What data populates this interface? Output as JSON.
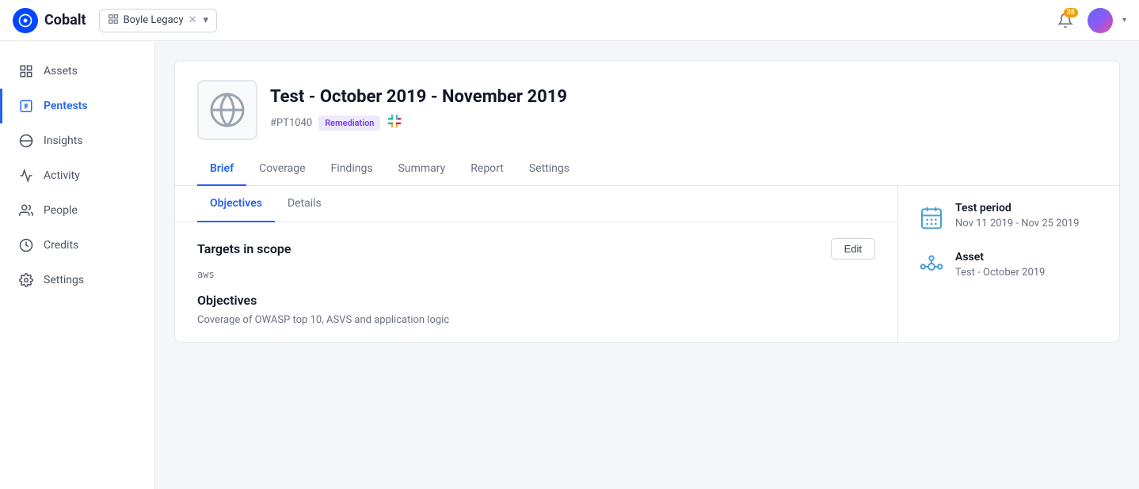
{
  "app": {
    "name": "Cobalt"
  },
  "topbar": {
    "org_selector": "Boyle Legacy",
    "notification_badge": "38",
    "icons": {
      "building": "🏢",
      "bell": "🔔",
      "chevron": "▾"
    }
  },
  "sidebar": {
    "items": [
      {
        "id": "assets",
        "label": "Assets",
        "active": false
      },
      {
        "id": "pentests",
        "label": "Pentests",
        "active": true
      },
      {
        "id": "insights",
        "label": "Insights",
        "active": false
      },
      {
        "id": "activity",
        "label": "Activity",
        "active": false
      },
      {
        "id": "people",
        "label": "People",
        "active": false
      },
      {
        "id": "credits",
        "label": "Credits",
        "active": false
      },
      {
        "id": "settings",
        "label": "Settings",
        "active": false
      }
    ]
  },
  "pentest": {
    "title": "Test - October 2019 - November 2019",
    "id": "#PT1040",
    "status": "Remediation"
  },
  "tabs": {
    "items": [
      {
        "id": "brief",
        "label": "Brief",
        "active": true
      },
      {
        "id": "coverage",
        "label": "Coverage",
        "active": false
      },
      {
        "id": "findings",
        "label": "Findings",
        "active": false
      },
      {
        "id": "summary",
        "label": "Summary",
        "active": false
      },
      {
        "id": "report",
        "label": "Report",
        "active": false
      },
      {
        "id": "settings",
        "label": "Settings",
        "active": false
      }
    ]
  },
  "sub_tabs": {
    "items": [
      {
        "id": "objectives",
        "label": "Objectives",
        "active": true
      },
      {
        "id": "details",
        "label": "Details",
        "active": false
      }
    ]
  },
  "targets": {
    "title": "Targets in scope",
    "edit_label": "Edit",
    "aws_tag": "aws"
  },
  "objectives": {
    "title": "Objectives",
    "text": "Coverage of OWASP top 10, ASVS and application logic"
  },
  "side_info": {
    "test_period": {
      "label": "Test period",
      "value": "Nov 11 2019 - Nov 25 2019"
    },
    "asset": {
      "label": "Asset",
      "value": "Test - October 2019"
    }
  }
}
